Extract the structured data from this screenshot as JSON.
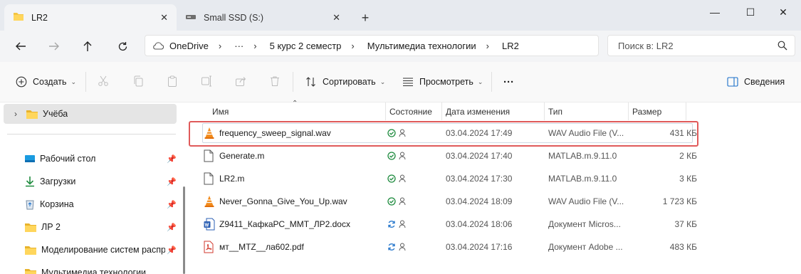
{
  "tabs": [
    {
      "label": "LR2",
      "active": true,
      "icon": "folder-icon"
    },
    {
      "label": "Small SSD (S:)",
      "active": false,
      "icon": "drive-icon"
    }
  ],
  "window": {
    "minimize": "—",
    "maximize": "☐",
    "close": "✕"
  },
  "address": {
    "root": "OneDrive",
    "ellipsis": "···",
    "segments": [
      "5 курс 2 семестр",
      "Мультимедиа технологии",
      "LR2"
    ]
  },
  "search": {
    "placeholder": "Поиск в: LR2"
  },
  "commands": {
    "new": "Создать",
    "sort": "Сортировать",
    "view": "Просмотреть",
    "more": "···",
    "details": "Сведения"
  },
  "sidebar": {
    "top_item": "Учёба",
    "items": [
      {
        "label": "Рабочий стол",
        "icon": "desktop-icon",
        "pinned": true
      },
      {
        "label": "Загрузки",
        "icon": "download-icon",
        "pinned": true
      },
      {
        "label": "Корзина",
        "icon": "recycle-bin-icon",
        "pinned": true
      },
      {
        "label": "ЛР 2",
        "icon": "folder-icon",
        "pinned": true
      },
      {
        "label": "Моделирование систем распре",
        "icon": "folder-icon",
        "pinned": true
      },
      {
        "label": "Мультимедиа технологии",
        "icon": "folder-icon",
        "pinned": false
      }
    ]
  },
  "columns": {
    "name": "Имя",
    "status": "Состояние",
    "date": "Дата изменения",
    "type": "Тип",
    "size": "Размер"
  },
  "files": [
    {
      "name": "frequency_sweep_signal.wav",
      "icon": "vlc-icon",
      "sync": "synced",
      "date": "03.04.2024 17:49",
      "type": "WAV Audio File (V...",
      "size": "431 КБ"
    },
    {
      "name": "Generate.m",
      "icon": "file-icon",
      "sync": "synced",
      "date": "03.04.2024 17:40",
      "type": "MATLAB.m.9.11.0",
      "size": "2 КБ"
    },
    {
      "name": "LR2.m",
      "icon": "file-icon",
      "sync": "synced",
      "date": "03.04.2024 17:30",
      "type": "MATLAB.m.9.11.0",
      "size": "3 КБ"
    },
    {
      "name": "Never_Gonna_Give_You_Up.wav",
      "icon": "vlc-icon",
      "sync": "synced",
      "date": "03.04.2024 18:09",
      "type": "WAV Audio File (V...",
      "size": "1 723 КБ"
    },
    {
      "name": "Z9411_КафкаРС_ММТ_ЛР2.docx",
      "icon": "word-icon",
      "sync": "syncing",
      "date": "03.04.2024 18:06",
      "type": "Документ Micros...",
      "size": "37 КБ"
    },
    {
      "name": "мт__MTZ__ла602.pdf",
      "icon": "pdf-icon",
      "sync": "syncing",
      "date": "03.04.2024 17:16",
      "type": "Документ Adobe ...",
      "size": "483 КБ"
    }
  ],
  "colors": {
    "highlight": "#e05a5a",
    "folder": "#f4c542",
    "accent": "#1a6fc9",
    "synced": "#1e8b3e"
  }
}
